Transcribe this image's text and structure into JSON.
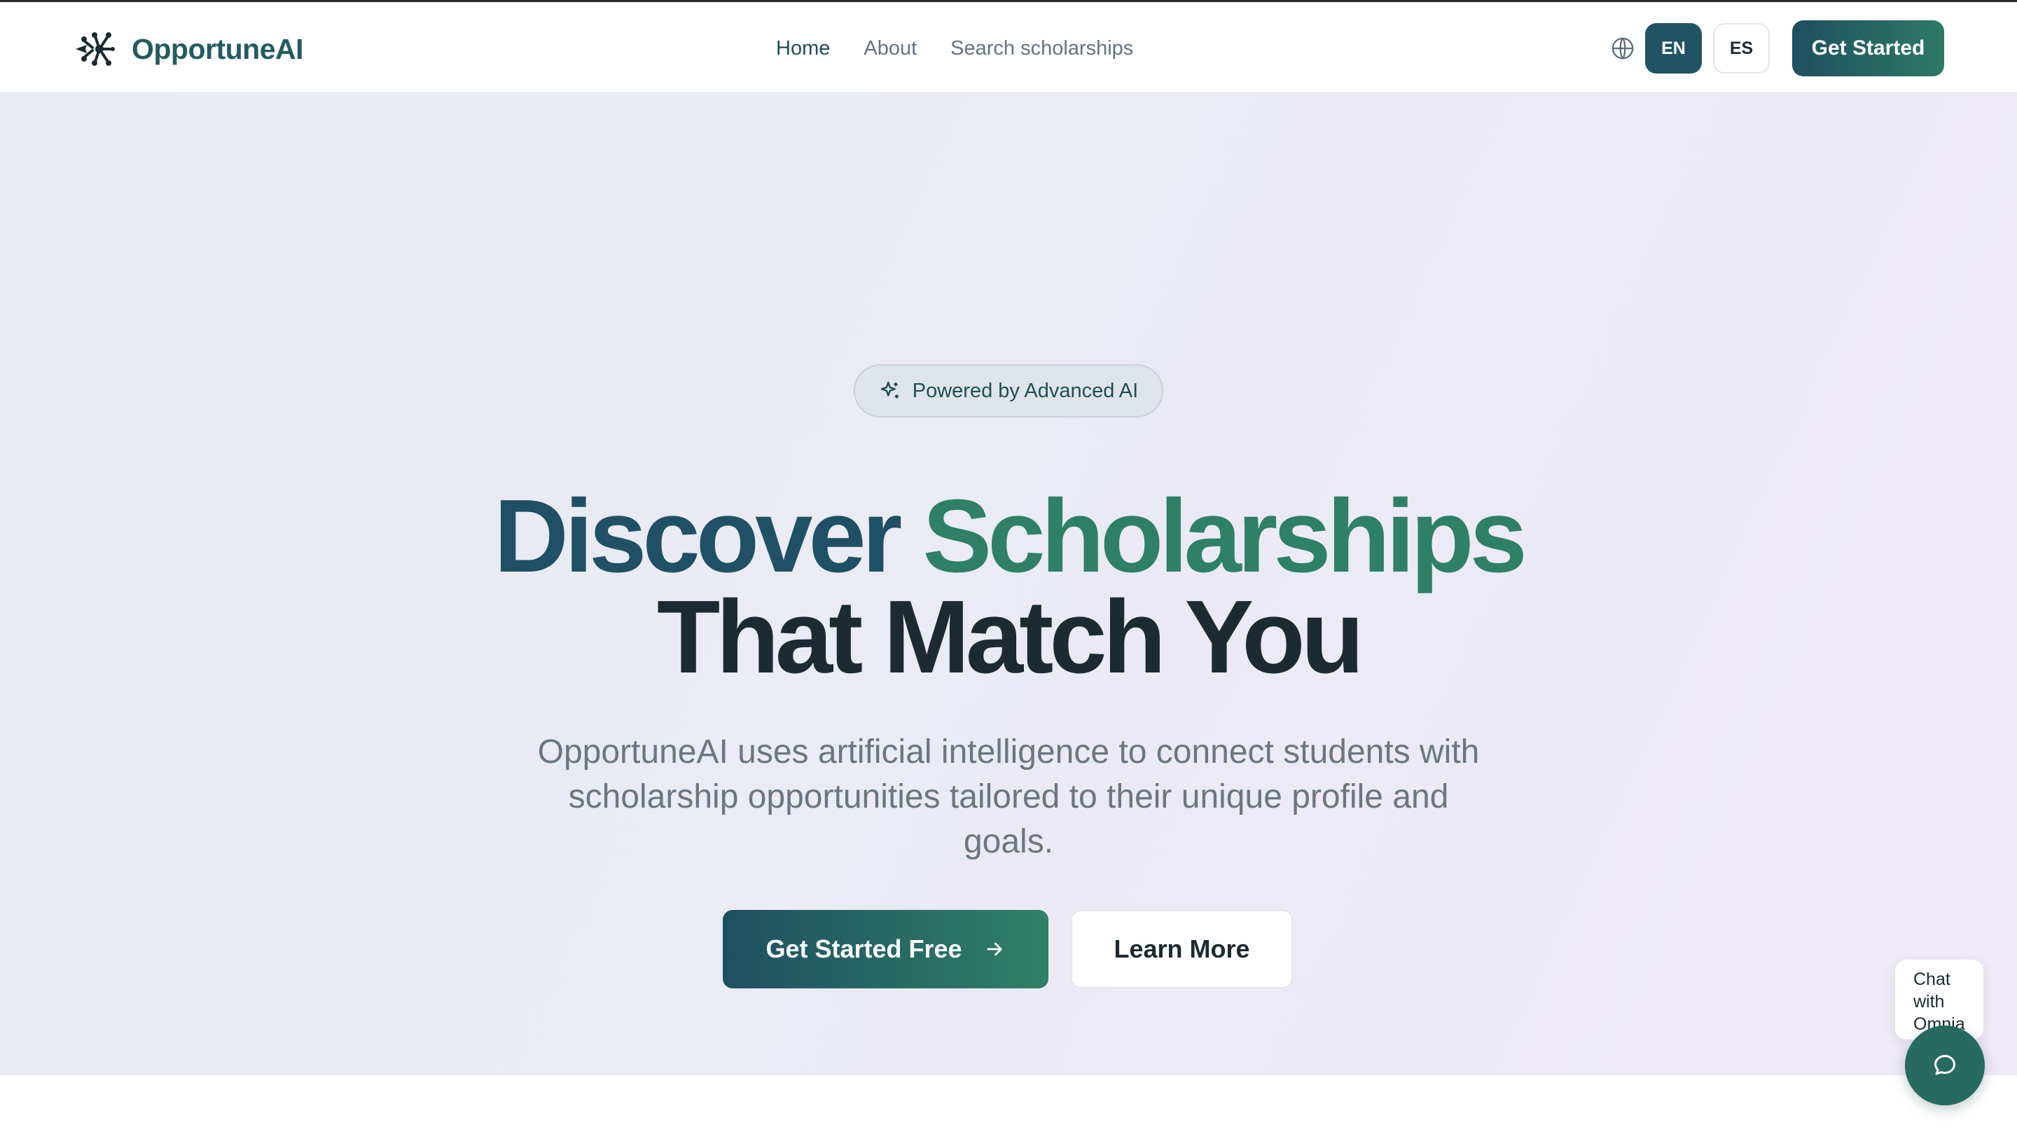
{
  "header": {
    "brand": "OpportuneAI",
    "nav": [
      {
        "label": "Home",
        "active": true
      },
      {
        "label": "About",
        "active": false
      },
      {
        "label": "Search scholarships",
        "active": false
      }
    ],
    "language": {
      "icon": "globe-icon",
      "options": [
        "EN",
        "ES"
      ],
      "selected": "EN"
    },
    "cta_label": "Get Started"
  },
  "hero": {
    "badge": {
      "icon": "sparkles-icon",
      "text": "Powered by Advanced AI"
    },
    "headline": {
      "word1": "Discover",
      "word2": "Scholarships",
      "line2": "That Match You"
    },
    "subtitle": "OpportuneAI uses artificial intelligence to connect students with scholarship opportunities tailored to their unique profile and goals.",
    "primary_button": {
      "label": "Get Started Free",
      "icon": "arrow-right-icon"
    },
    "secondary_button": {
      "label": "Learn More"
    }
  },
  "chat": {
    "tooltip": "Chat with Omnia",
    "icon": "message-circle-icon"
  },
  "colors": {
    "brand_dark": "#1f4f62",
    "brand_green": "#2e8066",
    "text_dark": "#1b2b31",
    "text_muted": "#6b7682"
  }
}
